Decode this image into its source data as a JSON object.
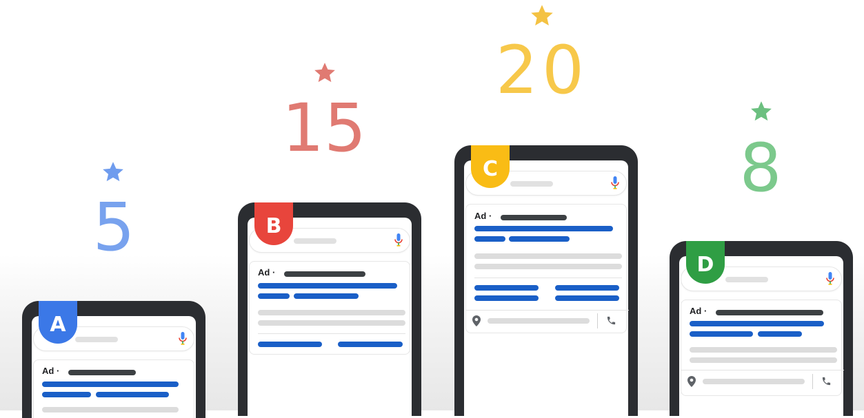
{
  "items": [
    {
      "id": "a",
      "badge": "A",
      "number": "5",
      "badge_color": "#3b78e7",
      "number_color": "#78a2ee",
      "star_color": "#6f9cee",
      "ad_label": "Ad",
      "dot": "·"
    },
    {
      "id": "b",
      "badge": "B",
      "number": "15",
      "badge_color": "#e8453c",
      "number_color": "#e07a72",
      "star_color": "#e07a72",
      "ad_label": "Ad",
      "dot": "·"
    },
    {
      "id": "c",
      "badge": "C",
      "number": "20",
      "badge_color": "#f9bc15",
      "number_color": "#f7c84a",
      "star_color": "#f4c243",
      "ad_label": "Ad",
      "dot": "·"
    },
    {
      "id": "d",
      "badge": "D",
      "number": "8",
      "badge_color": "#2f9e44",
      "number_color": "#7cc98c",
      "star_color": "#6cc080",
      "ad_label": "Ad",
      "dot": "·"
    }
  ],
  "icons": {
    "star": "star-icon",
    "mic": "microphone-icon",
    "pin": "map-pin-icon",
    "phone": "phone-icon"
  }
}
